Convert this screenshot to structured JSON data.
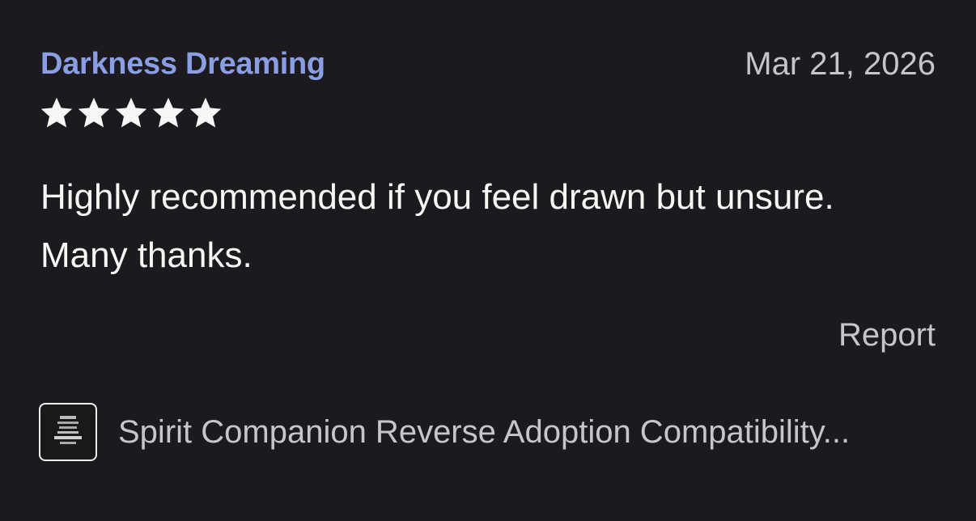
{
  "review": {
    "reviewer_name": "Darkness Dreaming",
    "date": "Mar 21, 2026",
    "rating": 5,
    "rating_max": 5,
    "body_lines": [
      "Highly recommended if you feel drawn but unsure.",
      "Many thanks."
    ],
    "report_label": "Report"
  },
  "product": {
    "title": "Spirit Companion Reverse Adoption Compatibility...",
    "thumbnail_icon": "product-thumbnail-icon"
  },
  "colors": {
    "background": "#1c1a1e",
    "reviewer_name": "#8a9fe3",
    "star": "#f7f6f4",
    "muted_text": "#c7c5c9",
    "body_text": "#f7f6f4"
  }
}
